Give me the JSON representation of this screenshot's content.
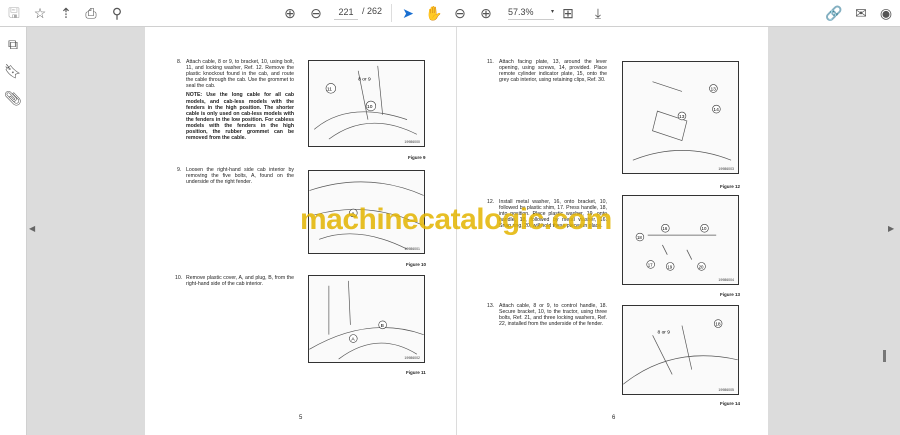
{
  "toolbar": {
    "page_current": "221",
    "page_total": "/ 262",
    "zoom": "57.3%"
  },
  "left_page": {
    "steps": [
      {
        "num": "8.",
        "text": "Attach cable, 8 or 9, to bracket, 10, using bolt, 11, and locking washer, Ref. 12. Remove the plastic knockout found in the cab, and route the cable through the cab. Use the grommet to seal the cab.",
        "note": "NOTE: Use the long cable for all cab models, and cab-less models with the fenders in the high position. The shorter cable is only used on cab-less models with the fenders in the low position. For cabless models with the fenders in the high position, the rubber grommet can be removed from the cable."
      },
      {
        "num": "9.",
        "text": "Loosen the right-hand side cab interior by removing the five bolts, A, found on the underside of the right fender."
      },
      {
        "num": "10.",
        "text": "Remove plastic cover, A, and plug, B, from the right-hand side of the cab interior."
      }
    ],
    "figures": [
      {
        "id": "19986000",
        "caption": "Figure 9",
        "callouts": [
          "8 or 9",
          "11",
          "10"
        ]
      },
      {
        "id": "19986001",
        "caption": "Figure 10",
        "callouts": [
          "A"
        ]
      },
      {
        "id": "19986002",
        "caption": "Figure 11",
        "callouts": [
          "A",
          "B"
        ]
      }
    ],
    "page_number": "5"
  },
  "right_page": {
    "steps": [
      {
        "num": "11.",
        "text": "Attach facing plate, 13, around the lever opening, using screws, 14, provided. Place remote cylinder indicator plate, 15, onto the grey cab interior, using retaining clips, Ref. 30."
      },
      {
        "num": "12.",
        "text": "Install metal washer, 16, onto bracket, 10, followed by plastic shim, 17. Press handle, 18, into position. Place plastic washer, 19, onto handle, 18, followed by metal washer, 16. Snap ring, 20, will hold these pieces in place."
      },
      {
        "num": "13.",
        "text": "Attach cable, 8 or 9, to control handle, 18. Secure bracket, 10, to the tractor, using three bolts, Ref. 21, and three locking washers, Ref. 22, installed from the underside of the fender."
      }
    ],
    "figures": [
      {
        "id": "19986003",
        "caption": "Figure 12",
        "callouts": [
          "13",
          "14",
          "13"
        ]
      },
      {
        "id": "19986004",
        "caption": "Figure 13",
        "callouts": [
          "16",
          "10",
          "18",
          "17",
          "19",
          "20"
        ]
      },
      {
        "id": "19986005",
        "caption": "Figure 14",
        "callouts": [
          "8 or 9",
          "18"
        ]
      }
    ],
    "page_number": "6"
  },
  "watermark": "machinecatalogic.com"
}
